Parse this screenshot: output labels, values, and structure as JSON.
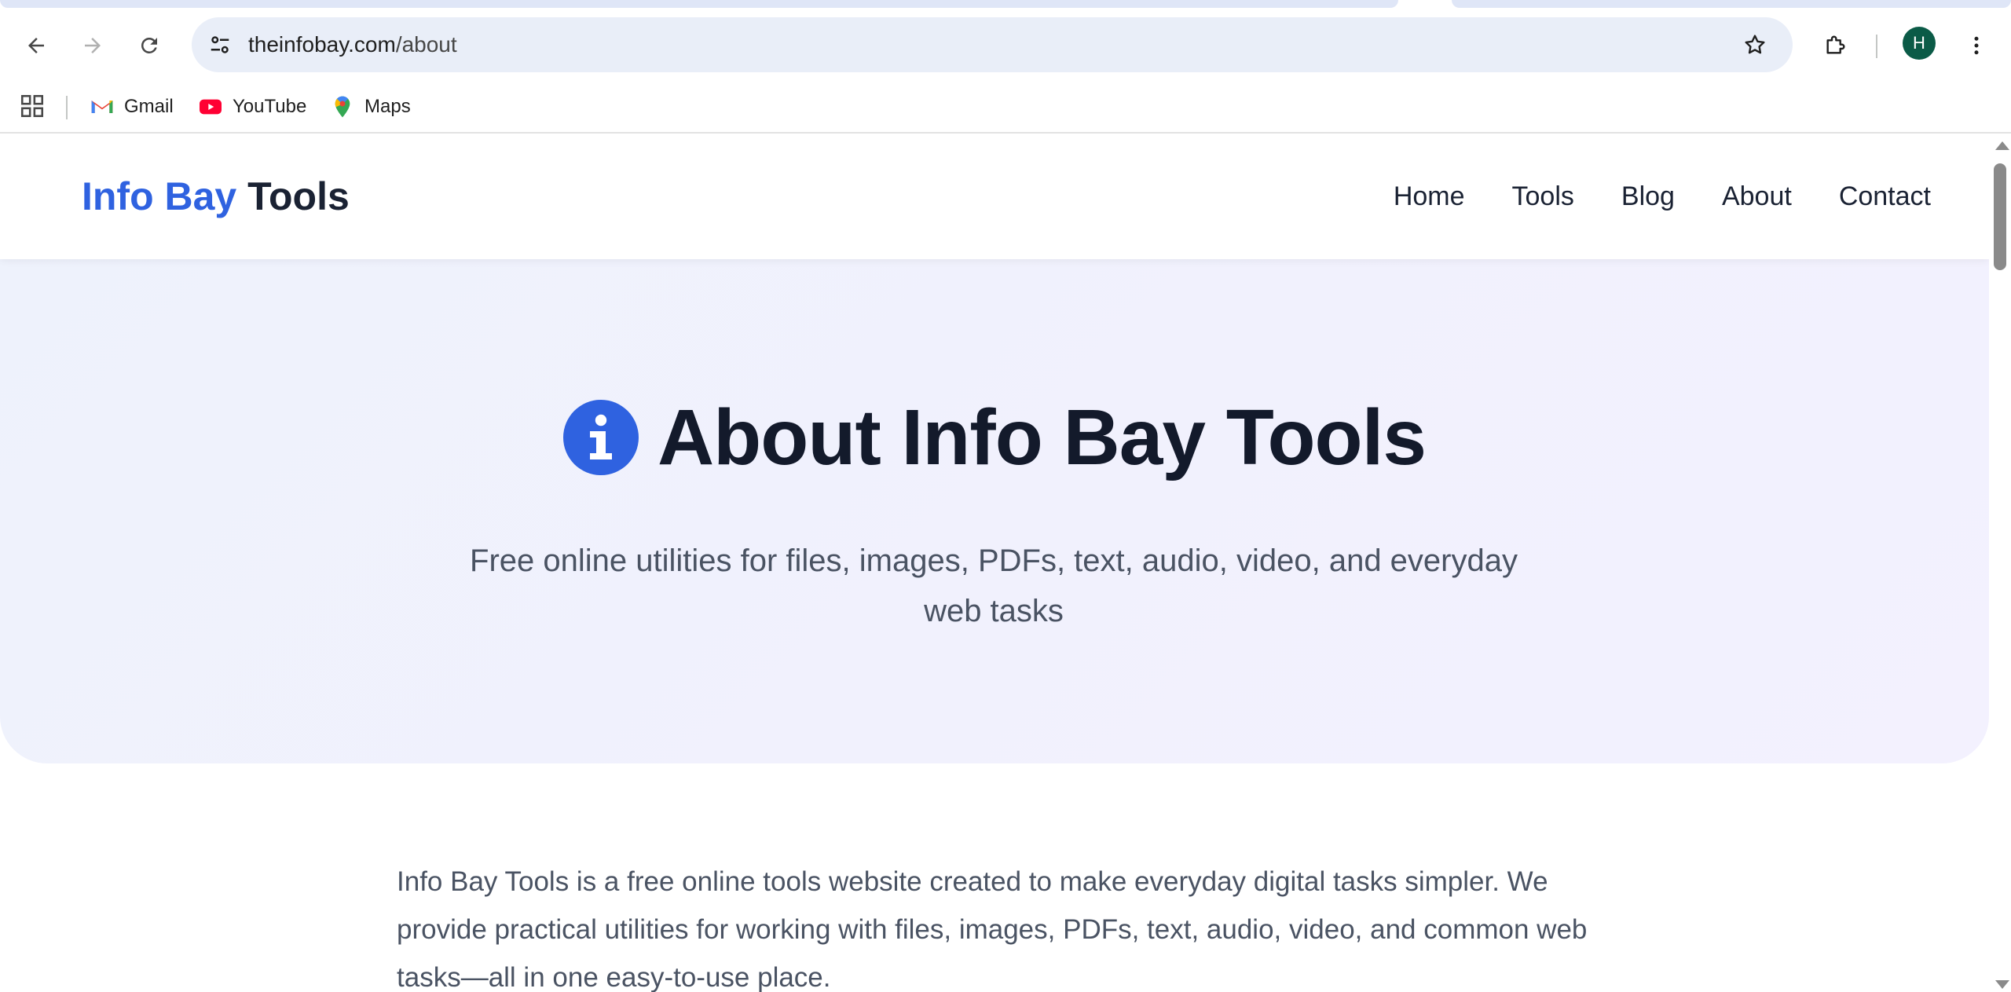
{
  "browser": {
    "url_domain": "theinfobay.com",
    "url_path": "/about",
    "profile_initial": "H",
    "bookmarks": [
      {
        "label": "Gmail",
        "icon": "gmail-icon"
      },
      {
        "label": "YouTube",
        "icon": "youtube-icon"
      },
      {
        "label": "Maps",
        "icon": "maps-icon"
      }
    ]
  },
  "site": {
    "logo_part1": "Info Bay",
    "logo_part2": "Tools",
    "nav": [
      "Home",
      "Tools",
      "Blog",
      "About",
      "Contact"
    ],
    "accent_color": "#2f62e0"
  },
  "hero": {
    "icon": "info-icon",
    "title": "About Info Bay Tools",
    "subtitle": "Free online utilities for files, images, PDFs, text, audio, video, and everyday web tasks"
  },
  "content": {
    "intro": "Info Bay Tools is a free online tools website created to make everyday digital tasks simpler. We provide practical utilities for working with files, images, PDFs, text, audio, video, and common web tasks—all in one easy-to-use place."
  }
}
